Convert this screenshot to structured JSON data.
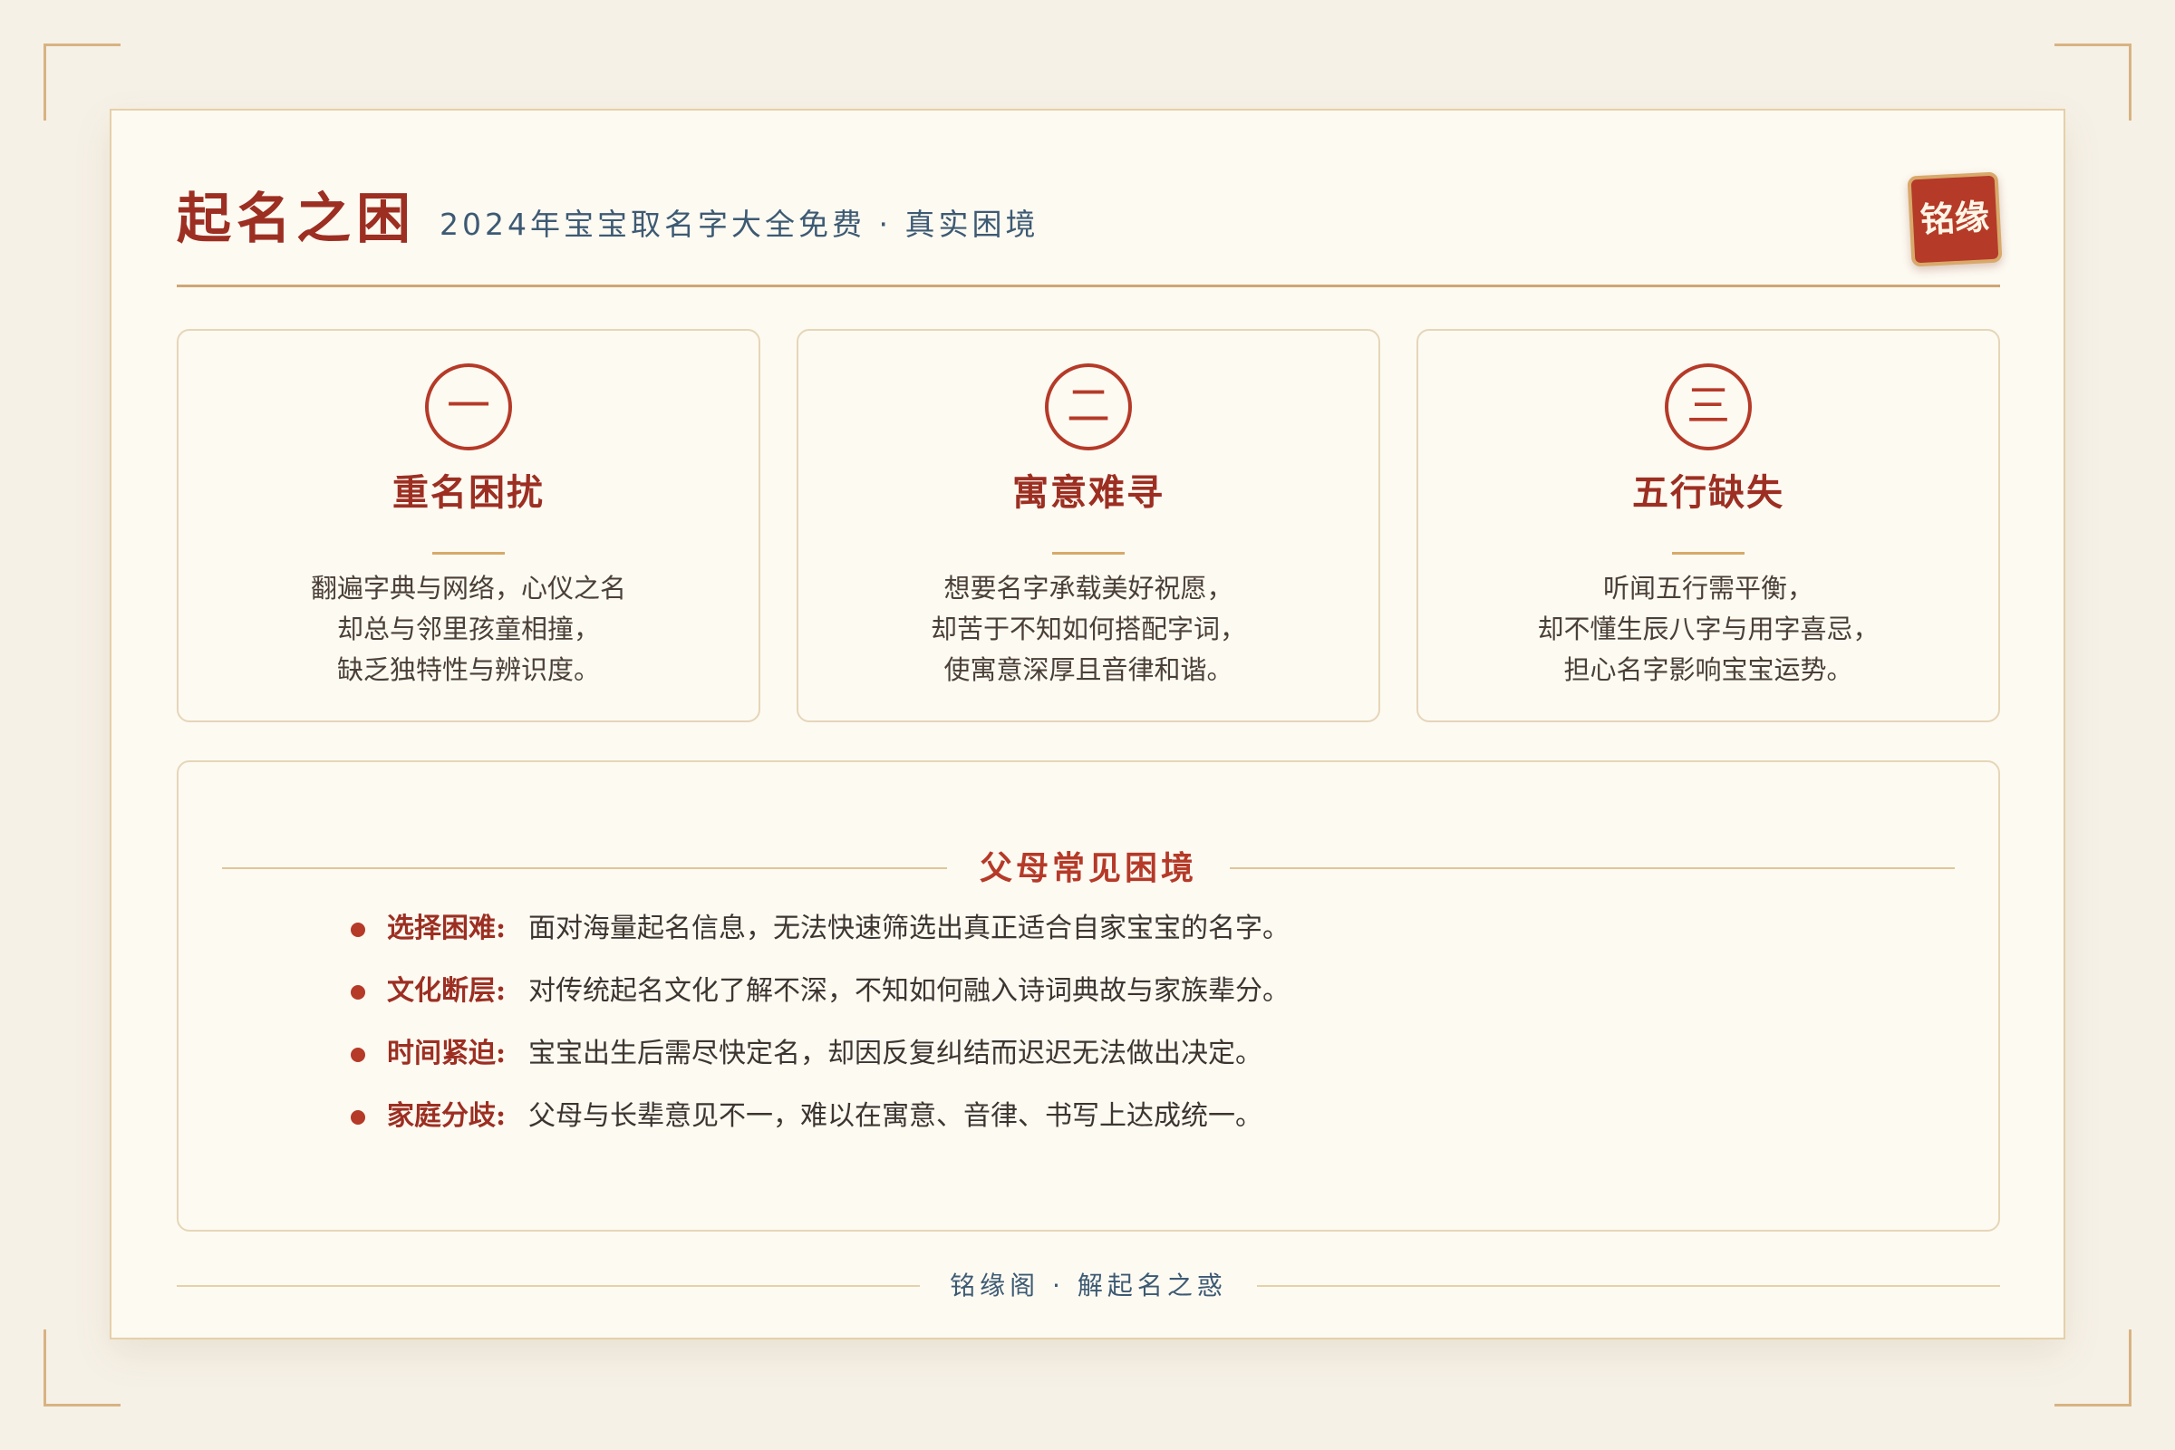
{
  "header": {
    "title": "起名之困",
    "subtitle": "2024年宝宝取名字大全免费 · 真实困境",
    "seal": "铭缘"
  },
  "cards": [
    {
      "number": "一",
      "title": "重名困扰",
      "lines": [
        "翻遍字典与网络，心仪之名",
        "却总与邻里孩童相撞，",
        "缺乏独特性与辨识度。"
      ]
    },
    {
      "number": "二",
      "title": "寓意难寻",
      "lines": [
        "想要名字承载美好祝愿，",
        "却苦于不知如何搭配字词，",
        "使寓意深厚且音律和谐。"
      ]
    },
    {
      "number": "三",
      "title": "五行缺失",
      "lines": [
        "听闻五行需平衡，",
        "却不懂生辰八字与用字喜忌，",
        "担心名字影响宝宝运势。"
      ]
    }
  ],
  "section": {
    "title": "父母常见困境",
    "items": [
      {
        "label": "选择困难:",
        "desc": "面对海量起名信息，无法快速筛选出真正适合自家宝宝的名字。"
      },
      {
        "label": "文化断层:",
        "desc": "对传统起名文化了解不深，不知如何融入诗词典故与家族辈分。"
      },
      {
        "label": "时间紧迫:",
        "desc": "宝宝出生后需尽快定名，却因反复纠结而迟迟无法做出决定。"
      },
      {
        "label": "家庭分歧:",
        "desc": "父母与长辈意见不一，难以在寓意、音律、书写上达成统一。"
      }
    ]
  },
  "footer": {
    "text": "铭缘阁 · 解起名之惑"
  },
  "colors": {
    "accent": "#b53a28",
    "title": "#9c2f22",
    "gold": "#cfa674",
    "background": "#f6f1e7",
    "paper": "#fdfaf2",
    "subtitle": "#3d5a73"
  }
}
